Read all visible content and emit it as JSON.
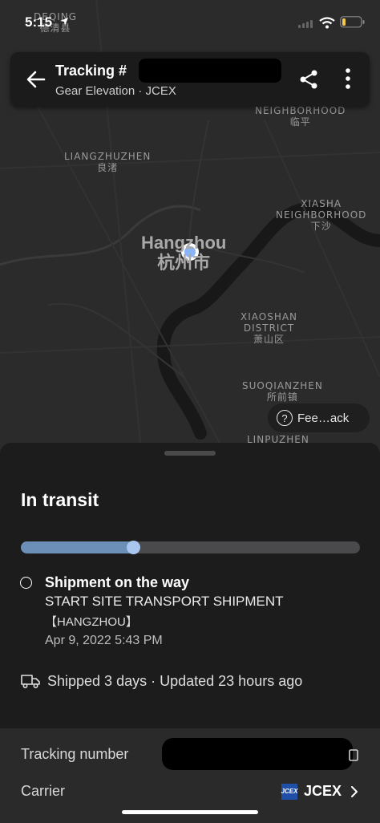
{
  "status_bar": {
    "time": "5:15"
  },
  "map": {
    "city_en": "Hangzhou",
    "city_zh": "杭州市",
    "labels": [
      {
        "id": "deqing",
        "lines": [
          "DEQING",
          "德清县"
        ]
      },
      {
        "id": "linping",
        "lines": [
          "NEIGHBORHOOD",
          "临平"
        ]
      },
      {
        "id": "liangzhu",
        "lines": [
          "LIANGZHUZHEN",
          "良渚"
        ]
      },
      {
        "id": "xiasha",
        "lines": [
          "XIASHA",
          "NEIGHBORHOOD",
          "下沙"
        ]
      },
      {
        "id": "xiaoshan",
        "lines": [
          "XIAOSHAN",
          "DISTRICT",
          "萧山区"
        ]
      },
      {
        "id": "suoqian",
        "lines": [
          "SUOQIANZHEN",
          "所前镇"
        ]
      },
      {
        "id": "linpu",
        "lines": [
          "LINPUZHEN"
        ]
      }
    ],
    "feedback_label": "Fee…ack"
  },
  "header": {
    "title": "Tracking #",
    "subtitle": "Gear Elevation · JCEX"
  },
  "shipment": {
    "status": "In transit",
    "progress": 0.33,
    "event_title": "Shipment on the way",
    "event_line1": "START SITE TRANSPORT SHIPMENT",
    "event_line2": "【HANGZHOU】",
    "event_date": "Apr 9, 2022  5:43 PM",
    "summary": "Shipped 3 days · Updated 23 hours ago"
  },
  "details": {
    "tracking_label": "Tracking number",
    "carrier_label": "Carrier",
    "carrier_name": "JCEX",
    "carrier_logo_text": "JCEX"
  },
  "colors": {
    "accent": "#6c8fb8",
    "knob": "#a9c7ee",
    "location": "#8ab4f8"
  }
}
